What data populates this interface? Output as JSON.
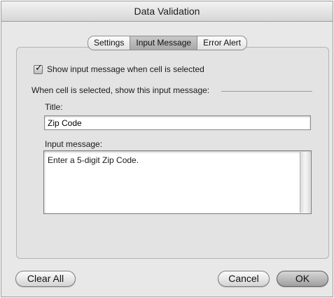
{
  "window": {
    "title": "Data Validation"
  },
  "tabs": [
    {
      "label": "Settings",
      "active": false
    },
    {
      "label": "Input Message",
      "active": true
    },
    {
      "label": "Error Alert",
      "active": false
    }
  ],
  "show_message_checkbox": {
    "label": "Show input message when cell is selected",
    "checked": true,
    "icon": "checkmark-icon"
  },
  "group_label": "When cell is selected, show this input message:",
  "title_field": {
    "label": "Title:",
    "value": "Zip Code"
  },
  "message_field": {
    "label": "Input message:",
    "value": "Enter a 5-digit Zip Code."
  },
  "buttons": {
    "clear_all": "Clear All",
    "cancel": "Cancel",
    "ok": "OK"
  }
}
